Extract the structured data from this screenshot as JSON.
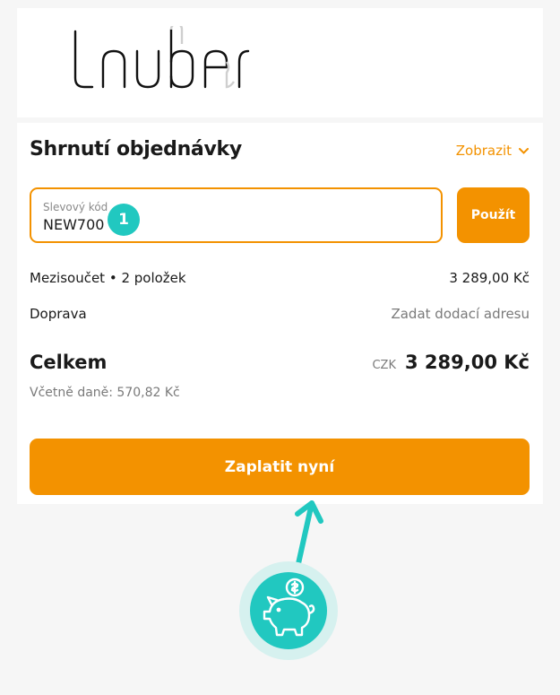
{
  "brand": {
    "logo_text": "Lauben"
  },
  "summary": {
    "title": "Shrnutí objednávky",
    "toggle_label": "Zobrazit"
  },
  "discount": {
    "label": "Slevový kód",
    "value": "NEW700",
    "apply_label": "Použít",
    "step_number": "1"
  },
  "lines": {
    "subtotal_label": "Mezisoučet • 2 položek",
    "subtotal_value": "3 289,00 Kč",
    "shipping_label": "Doprava",
    "shipping_value": "Zadat dodací adresu"
  },
  "total": {
    "label": "Celkem",
    "currency": "CZK",
    "amount": "3 289,00 Kč",
    "tax_note": "Včetně daně: 570,82 Kč"
  },
  "cta": {
    "pay_label": "Zaplatit nyní"
  },
  "colors": {
    "accent": "#f39200",
    "teal": "#21c8c0"
  },
  "icons": [
    "chevron-down-icon",
    "arrow-icon",
    "piggy-bank-icon"
  ]
}
